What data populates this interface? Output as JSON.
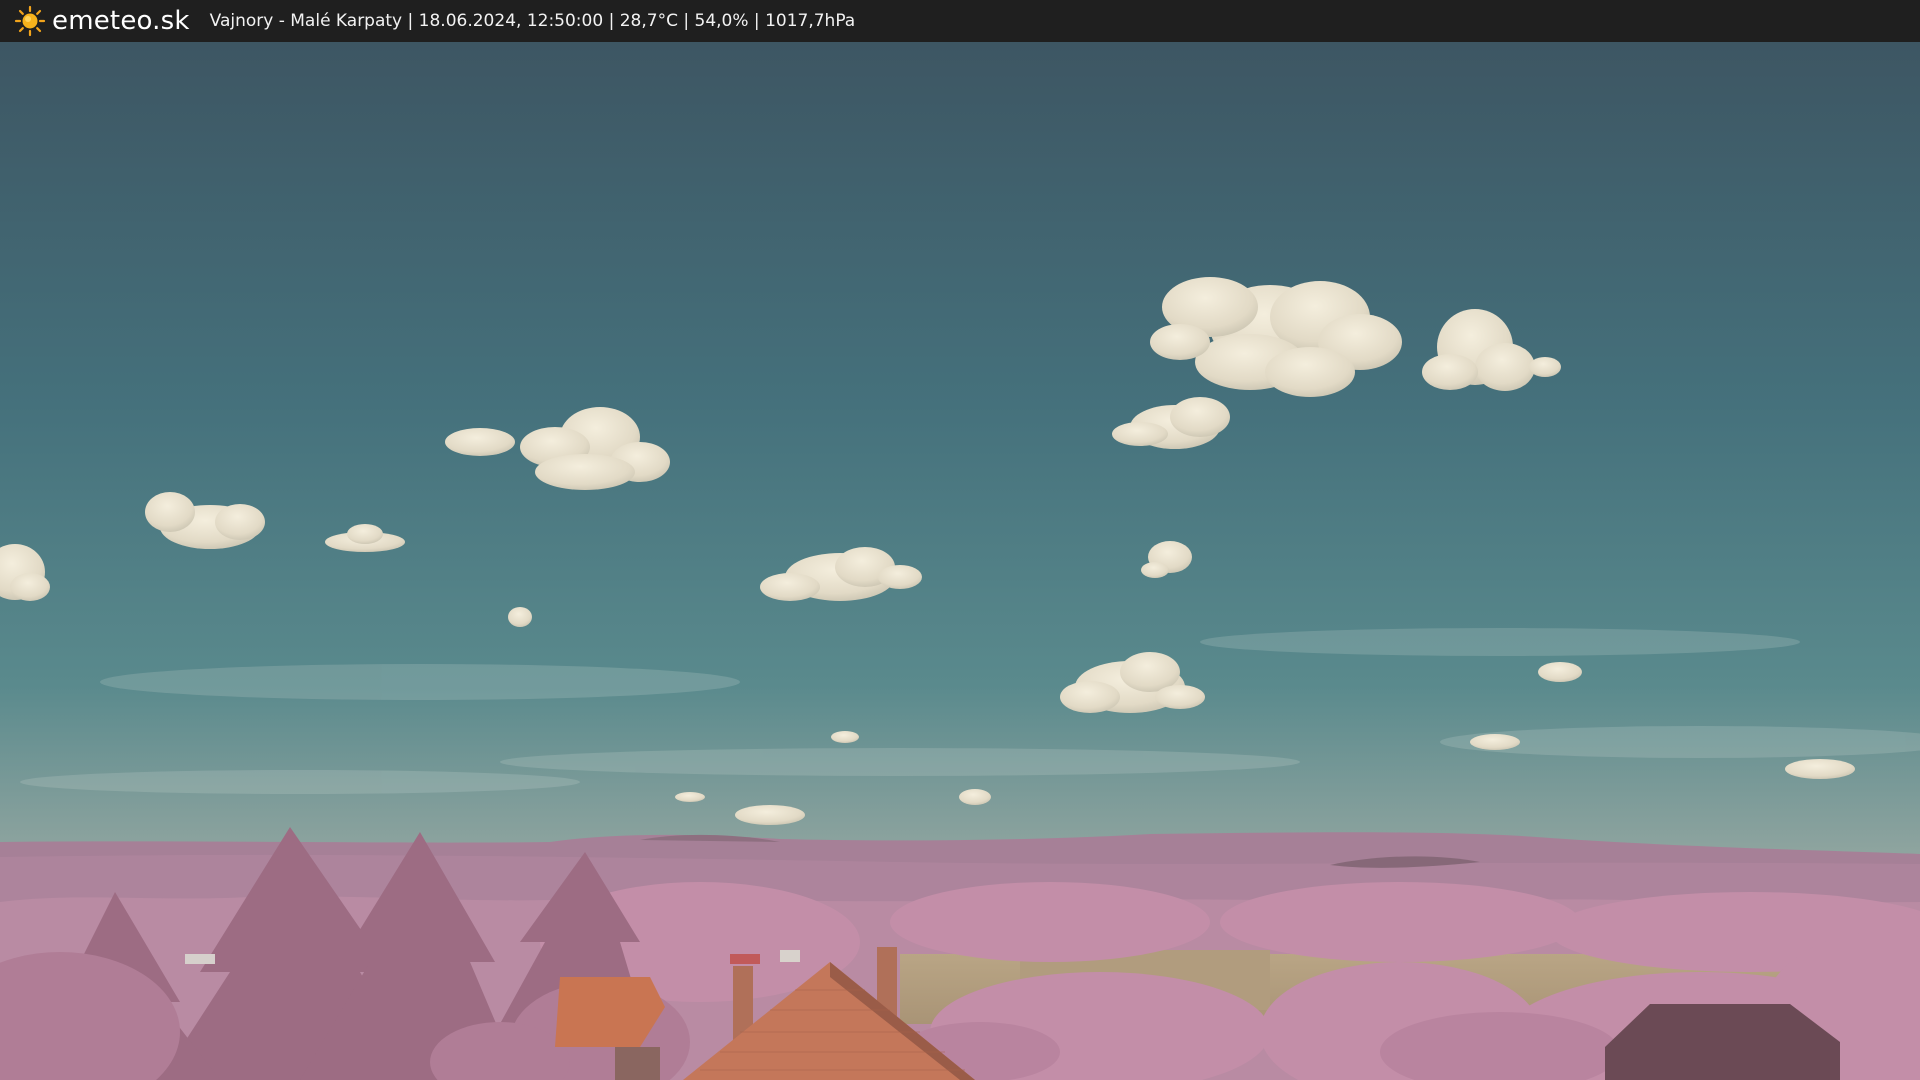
{
  "header": {
    "brand": "emeteo.sk",
    "logo_icon": "sun-icon",
    "location": "Vajnory - Malé Karpaty",
    "datetime": "18.06.2024, 12:50:00",
    "temperature": "28,7°C",
    "humidity": "54,0%",
    "pressure": "1017,7hPa",
    "separator": " | "
  },
  "colors": {
    "topbar": "#1f1f1f",
    "sky_top": "#3f5a66",
    "sky_mid": "#4a7b84",
    "sky_horizon": "#9aa49c",
    "hills": "#a37d93",
    "foliage": "#c08aa4",
    "field": "#b49f82",
    "roof": "#c9744f",
    "sun": "#f2a41c"
  }
}
